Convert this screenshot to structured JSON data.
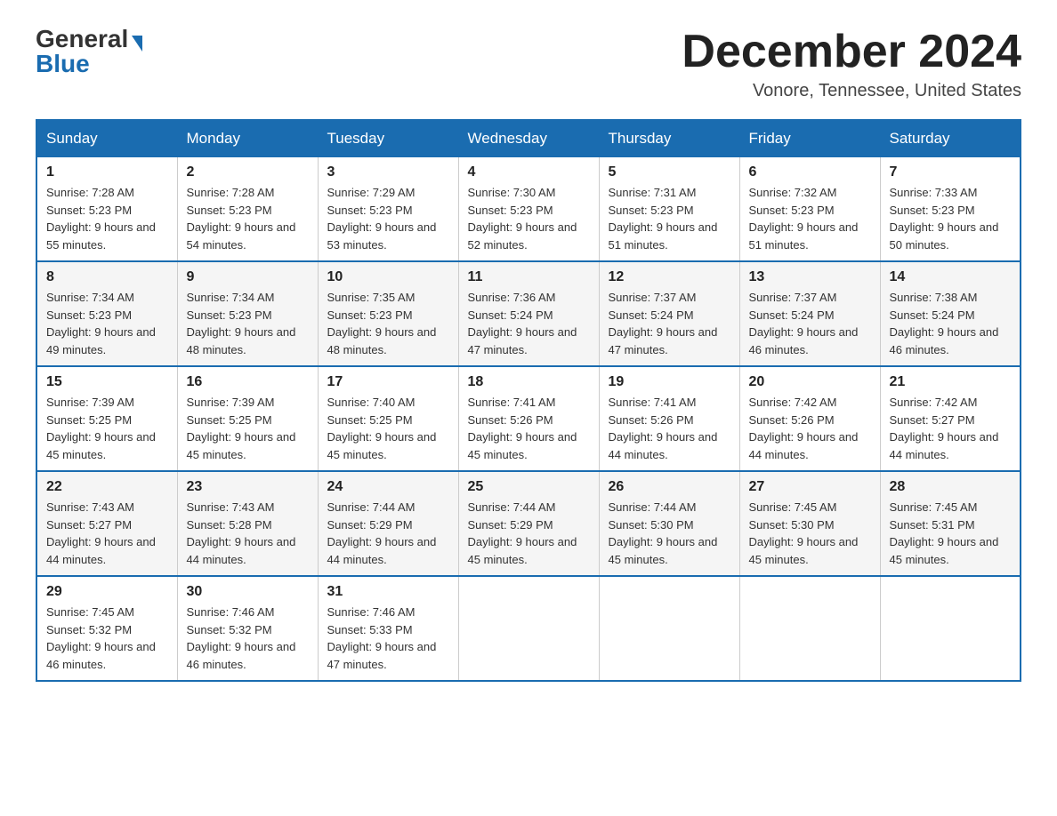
{
  "header": {
    "logo_general": "General",
    "logo_blue": "Blue",
    "month_title": "December 2024",
    "location": "Vonore, Tennessee, United States"
  },
  "days_of_week": [
    "Sunday",
    "Monday",
    "Tuesday",
    "Wednesday",
    "Thursday",
    "Friday",
    "Saturday"
  ],
  "weeks": [
    [
      {
        "num": "1",
        "sunrise": "7:28 AM",
        "sunset": "5:23 PM",
        "daylight": "9 hours and 55 minutes."
      },
      {
        "num": "2",
        "sunrise": "7:28 AM",
        "sunset": "5:23 PM",
        "daylight": "9 hours and 54 minutes."
      },
      {
        "num": "3",
        "sunrise": "7:29 AM",
        "sunset": "5:23 PM",
        "daylight": "9 hours and 53 minutes."
      },
      {
        "num": "4",
        "sunrise": "7:30 AM",
        "sunset": "5:23 PM",
        "daylight": "9 hours and 52 minutes."
      },
      {
        "num": "5",
        "sunrise": "7:31 AM",
        "sunset": "5:23 PM",
        "daylight": "9 hours and 51 minutes."
      },
      {
        "num": "6",
        "sunrise": "7:32 AM",
        "sunset": "5:23 PM",
        "daylight": "9 hours and 51 minutes."
      },
      {
        "num": "7",
        "sunrise": "7:33 AM",
        "sunset": "5:23 PM",
        "daylight": "9 hours and 50 minutes."
      }
    ],
    [
      {
        "num": "8",
        "sunrise": "7:34 AM",
        "sunset": "5:23 PM",
        "daylight": "9 hours and 49 minutes."
      },
      {
        "num": "9",
        "sunrise": "7:34 AM",
        "sunset": "5:23 PM",
        "daylight": "9 hours and 48 minutes."
      },
      {
        "num": "10",
        "sunrise": "7:35 AM",
        "sunset": "5:23 PM",
        "daylight": "9 hours and 48 minutes."
      },
      {
        "num": "11",
        "sunrise": "7:36 AM",
        "sunset": "5:24 PM",
        "daylight": "9 hours and 47 minutes."
      },
      {
        "num": "12",
        "sunrise": "7:37 AM",
        "sunset": "5:24 PM",
        "daylight": "9 hours and 47 minutes."
      },
      {
        "num": "13",
        "sunrise": "7:37 AM",
        "sunset": "5:24 PM",
        "daylight": "9 hours and 46 minutes."
      },
      {
        "num": "14",
        "sunrise": "7:38 AM",
        "sunset": "5:24 PM",
        "daylight": "9 hours and 46 minutes."
      }
    ],
    [
      {
        "num": "15",
        "sunrise": "7:39 AM",
        "sunset": "5:25 PM",
        "daylight": "9 hours and 45 minutes."
      },
      {
        "num": "16",
        "sunrise": "7:39 AM",
        "sunset": "5:25 PM",
        "daylight": "9 hours and 45 minutes."
      },
      {
        "num": "17",
        "sunrise": "7:40 AM",
        "sunset": "5:25 PM",
        "daylight": "9 hours and 45 minutes."
      },
      {
        "num": "18",
        "sunrise": "7:41 AM",
        "sunset": "5:26 PM",
        "daylight": "9 hours and 45 minutes."
      },
      {
        "num": "19",
        "sunrise": "7:41 AM",
        "sunset": "5:26 PM",
        "daylight": "9 hours and 44 minutes."
      },
      {
        "num": "20",
        "sunrise": "7:42 AM",
        "sunset": "5:26 PM",
        "daylight": "9 hours and 44 minutes."
      },
      {
        "num": "21",
        "sunrise": "7:42 AM",
        "sunset": "5:27 PM",
        "daylight": "9 hours and 44 minutes."
      }
    ],
    [
      {
        "num": "22",
        "sunrise": "7:43 AM",
        "sunset": "5:27 PM",
        "daylight": "9 hours and 44 minutes."
      },
      {
        "num": "23",
        "sunrise": "7:43 AM",
        "sunset": "5:28 PM",
        "daylight": "9 hours and 44 minutes."
      },
      {
        "num": "24",
        "sunrise": "7:44 AM",
        "sunset": "5:29 PM",
        "daylight": "9 hours and 44 minutes."
      },
      {
        "num": "25",
        "sunrise": "7:44 AM",
        "sunset": "5:29 PM",
        "daylight": "9 hours and 45 minutes."
      },
      {
        "num": "26",
        "sunrise": "7:44 AM",
        "sunset": "5:30 PM",
        "daylight": "9 hours and 45 minutes."
      },
      {
        "num": "27",
        "sunrise": "7:45 AM",
        "sunset": "5:30 PM",
        "daylight": "9 hours and 45 minutes."
      },
      {
        "num": "28",
        "sunrise": "7:45 AM",
        "sunset": "5:31 PM",
        "daylight": "9 hours and 45 minutes."
      }
    ],
    [
      {
        "num": "29",
        "sunrise": "7:45 AM",
        "sunset": "5:32 PM",
        "daylight": "9 hours and 46 minutes."
      },
      {
        "num": "30",
        "sunrise": "7:46 AM",
        "sunset": "5:32 PM",
        "daylight": "9 hours and 46 minutes."
      },
      {
        "num": "31",
        "sunrise": "7:46 AM",
        "sunset": "5:33 PM",
        "daylight": "9 hours and 47 minutes."
      },
      null,
      null,
      null,
      null
    ]
  ],
  "labels": {
    "sunrise": "Sunrise: ",
    "sunset": "Sunset: ",
    "daylight": "Daylight: "
  }
}
